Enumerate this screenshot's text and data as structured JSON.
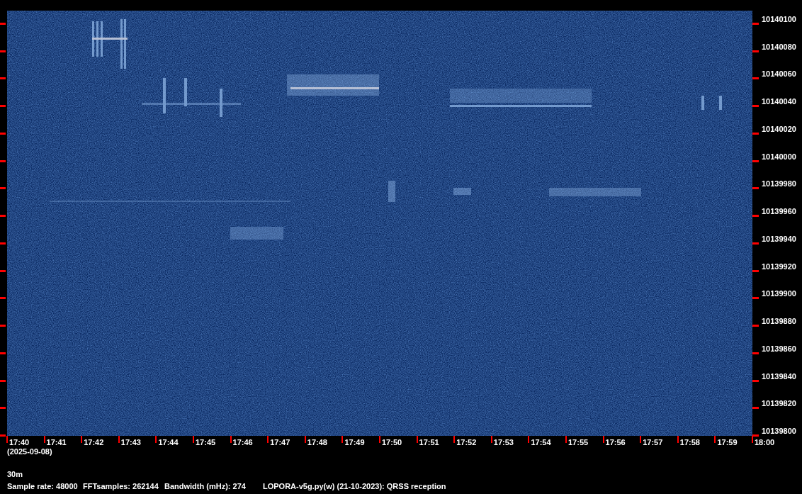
{
  "frequency_labels": [
    "10140100",
    "10140080",
    "10140060",
    "10140040",
    "10140020",
    "10140000",
    "10139980",
    "10139960",
    "10139940",
    "10139920",
    "10139900",
    "10139880",
    "10139860",
    "10139840",
    "10139820",
    "10139800"
  ],
  "time_labels": [
    "17:40",
    "17:41",
    "17:42",
    "17:43",
    "17:44",
    "17:45",
    "17:46",
    "17:47",
    "17:48",
    "17:49",
    "17:50",
    "17:51",
    "17:52",
    "17:53",
    "17:54",
    "17:55",
    "17:56",
    "17:57",
    "17:58",
    "17:59",
    "18:00"
  ],
  "date": "(2025-09-08)",
  "band": "30m",
  "info": [
    "Sample rate: 48000",
    "FFTsamples: 262144",
    "Bandwidth (mHz): 274",
    "LOPORA-v5g.py(w) (21-10-2023): QRSS reception"
  ]
}
